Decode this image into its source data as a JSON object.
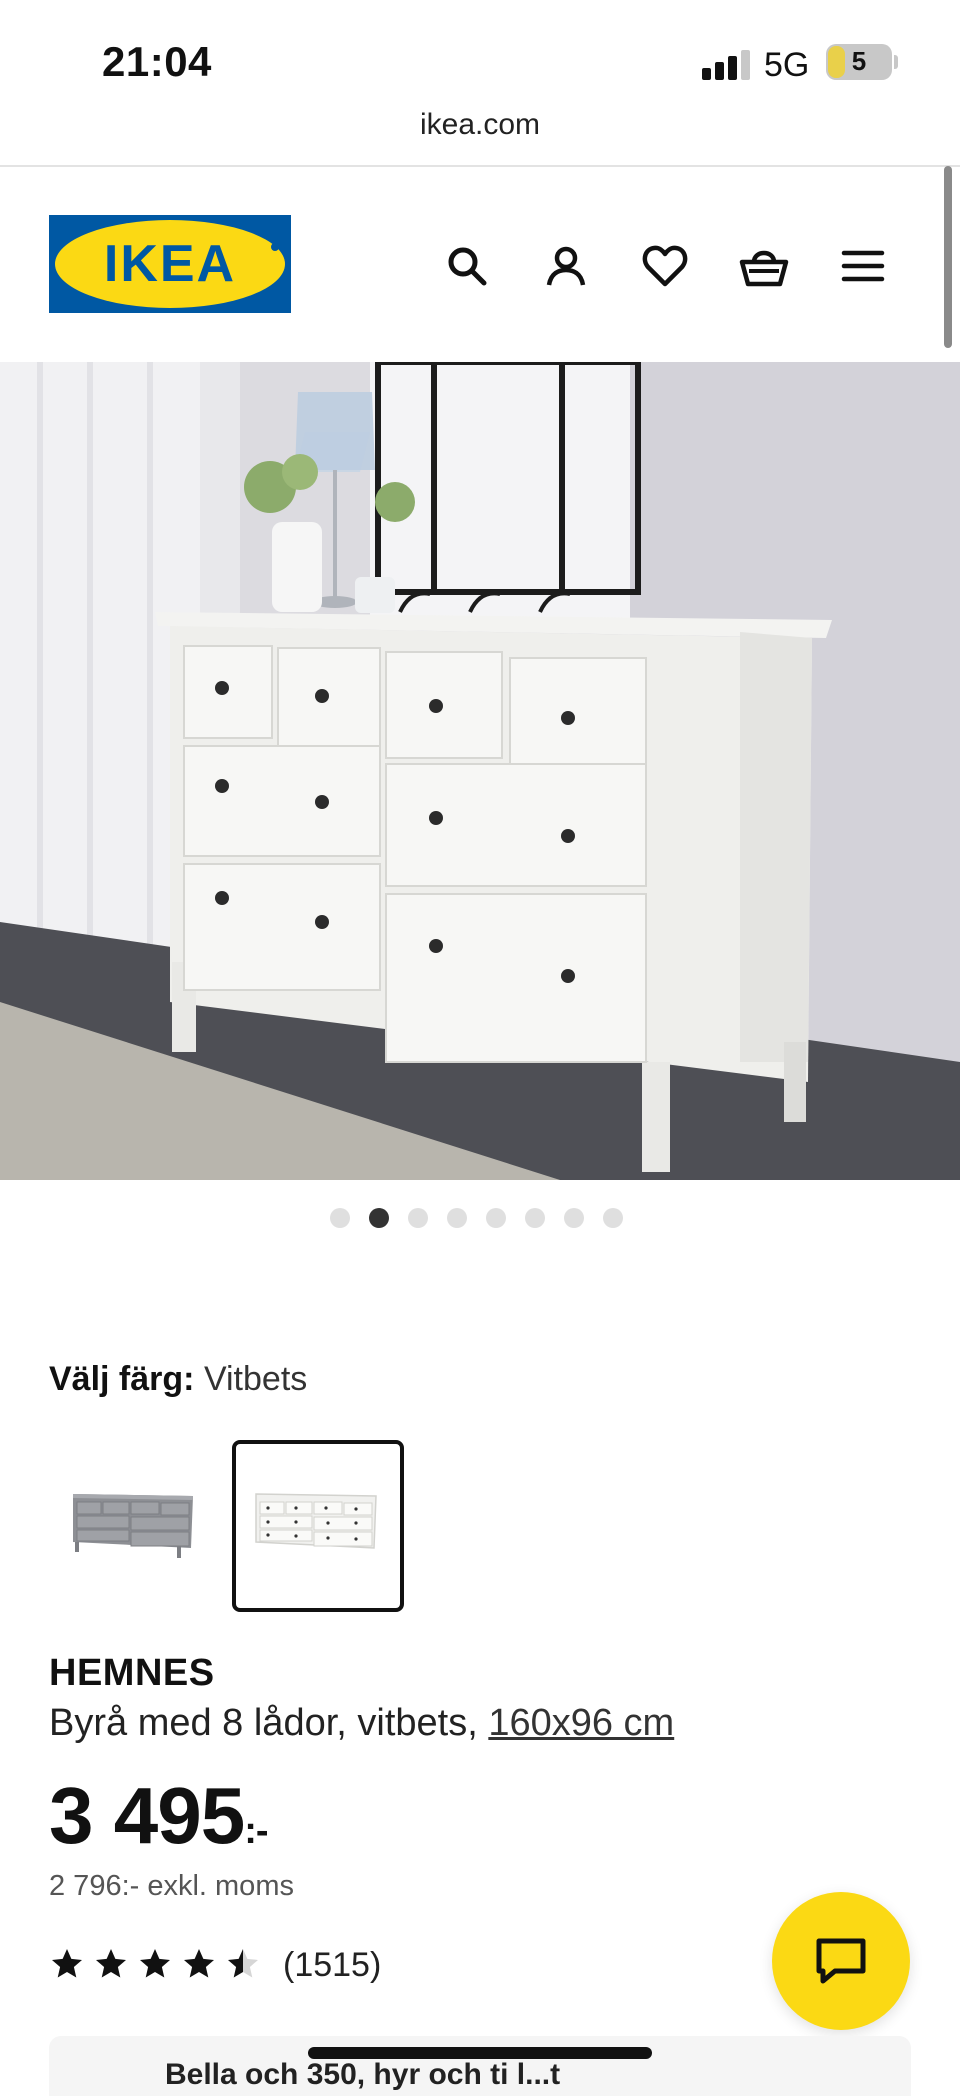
{
  "status_bar": {
    "time": "21:04",
    "network": "5G",
    "battery": "5",
    "battery_fraction": 0.26
  },
  "browser": {
    "url": "ikea.com"
  },
  "header": {
    "logo_text": "IKEA",
    "icons": [
      "search-icon",
      "account-icon",
      "heart-icon",
      "cart-icon",
      "menu-icon"
    ]
  },
  "gallery": {
    "image_count": 8,
    "active_index": 1
  },
  "color_picker": {
    "label": "Välj färg:",
    "selected_value": "Vitbets",
    "options": [
      "grey",
      "white"
    ],
    "selected_option_index": 1
  },
  "product": {
    "name": "HEMNES",
    "description": "Byrå med 8 lådor, vitbets,",
    "dimensions": "160x96 cm",
    "price": "3 495",
    "price_suffix": ":-",
    "price_excl": "2 796:- exkl. moms",
    "rating": 4.5,
    "rating_count": "(1515)"
  },
  "bottom_card": {
    "text": "Bella och 350, hyr och ti l...t"
  },
  "colors": {
    "ikea_blue": "#0058a3",
    "ikea_yellow": "#fbd914"
  }
}
